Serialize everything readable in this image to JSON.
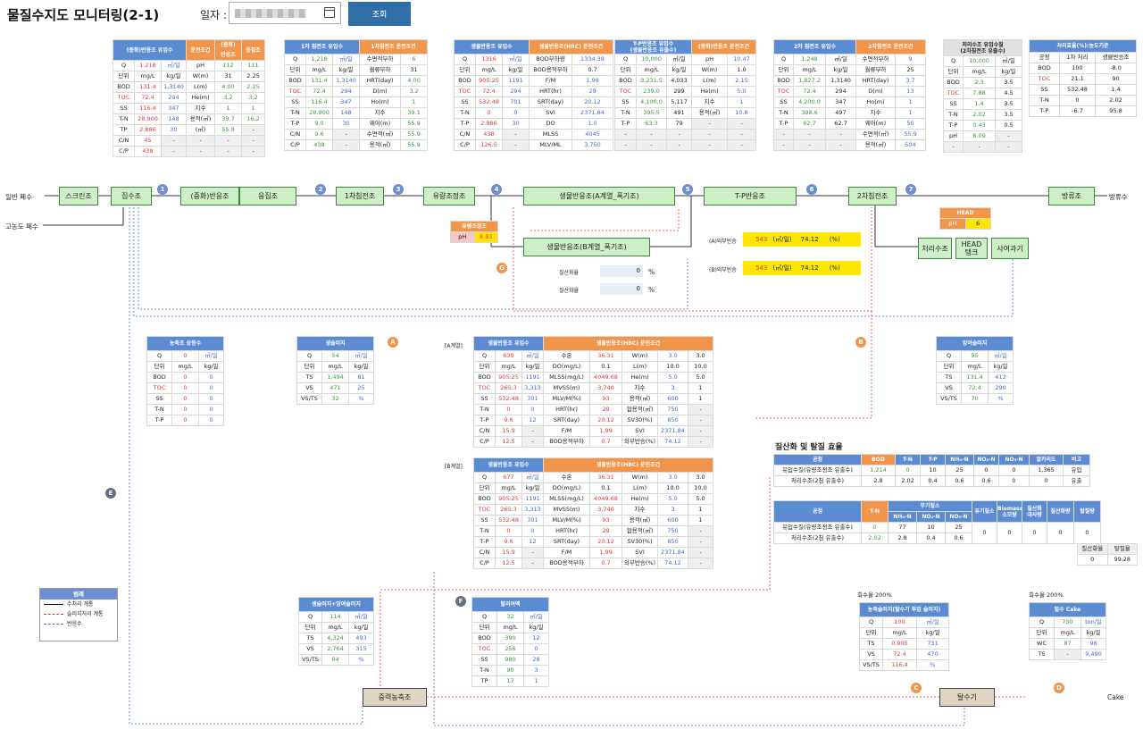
{
  "header": {
    "title": "물질수지도 모니터링(2-1)",
    "date_label": "일자 :",
    "search_label": "조회"
  },
  "flow": {
    "inlet_general": "일반 폐수",
    "inlet_high": "고농도 폐수",
    "outlet": "방류수",
    "cake": "Cake",
    "screen": "스크린조",
    "collect": "집수조",
    "neutral": "(중화)반응조",
    "coag": "응집조",
    "primary": "1차침전조",
    "eq": "유량조정조",
    "bio_a": "생물반응조(A계열_폭기조)",
    "bio_b": "생물반응조(B계열_폭기조)",
    "tp": "T-P반응조",
    "secondary": "2차침전조",
    "discharge": "방류조",
    "treat": "처리수조",
    "head": "HEAD\n탱크",
    "sand": "사여과기",
    "thickener": "중력농축조",
    "dewater": "탈수기",
    "ph_eq_title": "유량조정조",
    "ph_eq_label": "pH",
    "ph_eq_value": "8.93",
    "head_title": "HEAD",
    "head_ph_label": "pH",
    "head_ph_value": "6",
    "ret_a_label": "(A)외부반송",
    "ret_a_val": "543",
    "ret_a_unit": "(㎥/일)",
    "ret_a_pct": "74.12",
    "ret_a_pu": "(%)",
    "ret_b_label": "(B)외부반송",
    "ret_b_val": "543",
    "ret_b_unit": "(㎥/일)",
    "ret_b_pct": "74.12",
    "ret_b_pu": "(%)",
    "nit1_label": "질산화율",
    "nit1_val": "0",
    "nit1_unit": "%",
    "nit2_label": "질산화율",
    "nit2_val": "0",
    "nit2_unit": "%",
    "circles": [
      "1",
      "2",
      "3",
      "4",
      "5",
      "6",
      "7",
      "G",
      "A",
      "B",
      "E",
      "F",
      "C",
      "D"
    ]
  },
  "tables": {
    "t1": {
      "h": [
        "(중화)반응조 유입수",
        "운전조건",
        "(중화)\n반응조",
        "응집조"
      ],
      "rows": [
        [
          "Q",
          "1,218",
          "㎥/일",
          "pH",
          "112",
          "111"
        ],
        [
          "단위",
          "mg/L",
          "kg/일",
          "W(m)",
          "31",
          "2.25"
        ],
        [
          "BOD",
          "131.4",
          "1,3140",
          "L(m)",
          "4.00",
          "2.25"
        ],
        [
          "TOC",
          "72.4",
          "294",
          "He(m)",
          "3.2",
          "3.2"
        ],
        [
          "SS",
          "116.4",
          "347",
          "지수",
          "1",
          "1"
        ],
        [
          "T-N",
          "28.900",
          "148",
          "용적(㎥)",
          "39.7",
          "16.2"
        ],
        [
          "TP",
          "2.886",
          "30",
          "(㎥)",
          "55.9",
          "-"
        ],
        [
          "C/N",
          "45",
          "-",
          "-",
          "-",
          "-"
        ],
        [
          "C/P",
          "438",
          "-",
          "-",
          "-",
          "-"
        ]
      ]
    },
    "t2": {
      "h": [
        "1차 침전조 유입수",
        "1차침전조 운전조건"
      ],
      "rows": [
        [
          "Q",
          "1,218",
          "㎥/일",
          "수면적부하",
          "6"
        ],
        [
          "단위",
          "mg/L",
          "kg/일",
          "월류부하",
          "31"
        ],
        [
          "BOD",
          "131.4",
          "1,3140",
          "HRT(day)",
          "4.00"
        ],
        [
          "TOC",
          "72.4",
          "294",
          "D(m)",
          "3.2"
        ],
        [
          "SS",
          "116.4",
          "347",
          "Ho(m)",
          "1"
        ],
        [
          "T-N",
          "28.900",
          "148",
          "지수",
          "39.1"
        ],
        [
          "T-P",
          "9.0",
          "30",
          "웨어(m)",
          "55.9"
        ],
        [
          "C/N",
          "9.6",
          "-",
          "수면적(㎡)",
          "55.9"
        ],
        [
          "C/P",
          "438",
          "-",
          "용적(㎥)",
          "55.9"
        ]
      ]
    },
    "t3": {
      "h": [
        "생물반응조 유입수",
        "생물반응조(HRC) 운전조건"
      ],
      "rows": [
        [
          "Q",
          "1316",
          "㎥/일",
          "BOD부하량",
          "1334.38"
        ],
        [
          "단위",
          "mg/L",
          "kg/일",
          "BOD용적부하",
          "0.7"
        ],
        [
          "BOD",
          "905.25",
          "1191",
          "F/M",
          "1.99"
        ],
        [
          "TOC",
          "72.4",
          "294",
          "HRT(hr)",
          "29"
        ],
        [
          "SS",
          "532.48",
          "701",
          "SRT(day)",
          "20.12"
        ],
        [
          "T-N",
          "0",
          "0",
          "SVI",
          "2371.84"
        ],
        [
          "T-P",
          "2.886",
          "30",
          "DO",
          "1.0"
        ],
        [
          "C/N",
          "438",
          "-",
          "MLSS",
          "4045"
        ],
        [
          "C/P",
          "126.5",
          "-",
          "MLV/ML",
          "3.750"
        ]
      ]
    },
    "t4": {
      "h": [
        "T-P반응조 유입수\n(생물반응조 유출수)",
        "(중화)반응조 운전조건"
      ],
      "rows": [
        [
          "Q",
          "10,000",
          "㎥/일",
          "pH",
          "10.47"
        ],
        [
          "단위",
          "mg/L",
          "kg/일",
          "W(m)",
          "1.0"
        ],
        [
          "BOD",
          "3,231.5",
          "4,033",
          "L(m)",
          "2.15"
        ],
        [
          "TOC",
          "239.0",
          "299",
          "He(m)",
          "5.0"
        ],
        [
          "SS",
          "4,100.0",
          "5,117",
          "지수",
          "1"
        ],
        [
          "T-N",
          "395.5",
          "491",
          "용적(㎥)",
          "10.8"
        ],
        [
          "T-P",
          "63.3",
          "79",
          "-",
          "-"
        ],
        [
          "-",
          "-",
          "-",
          "-",
          "-"
        ],
        [
          "-",
          "-",
          "-",
          "-",
          "-"
        ]
      ]
    },
    "t5": {
      "h": [
        "2차 침전조 유입수",
        "2차침전조 운전조건"
      ],
      "rows": [
        [
          "Q",
          "1,248",
          "㎥/일",
          "수면적부하",
          "9"
        ],
        [
          "단위",
          "mg/L",
          "kg/일",
          "월류부하",
          "25"
        ],
        [
          "BOD",
          "1,827.2",
          "1,3140",
          "HRT(day)",
          "3.7"
        ],
        [
          "TOC",
          "72.4",
          "294",
          "D(m)",
          "13"
        ],
        [
          "SS",
          "4,200.0",
          "347",
          "Ho(m)",
          "1"
        ],
        [
          "T-N",
          "398.6",
          "497",
          "지수",
          "1"
        ],
        [
          "T-P",
          "62.7",
          "62.7",
          "웨어(m)",
          "50"
        ],
        [
          "-",
          "-",
          "-",
          "수면적(㎡)",
          "55.9"
        ],
        [
          "-",
          "-",
          "-",
          "용적(㎥)",
          "504"
        ]
      ]
    },
    "t6": {
      "h": [
        "처리수조 유입수질\n(2차침전조 유출수)"
      ],
      "rows": [
        [
          "Q",
          "10,000",
          "㎥/일"
        ],
        [
          "단위",
          "mg/L",
          "kg/일"
        ],
        [
          "BOD",
          "2.3",
          "3.5"
        ],
        [
          "TOC",
          "7.88",
          "4.5"
        ],
        [
          "SS",
          "1.4",
          "3.5"
        ],
        [
          "T-N",
          "2.02",
          "3.5"
        ],
        [
          "T-P",
          "0.43",
          "0.5"
        ],
        [
          "pH",
          "8.09",
          "-"
        ],
        [
          "-",
          "-",
          "-"
        ]
      ]
    },
    "t7": {
      "h": [
        "처리효율(%):농도기준"
      ],
      "rows": [
        [
          "공정",
          "1차 처리",
          "생물반응조"
        ],
        [
          "BOD",
          "100",
          "-8.0"
        ],
        [
          "TOC",
          "21.1",
          "90"
        ],
        [
          "SS",
          "532.48",
          "1.4"
        ],
        [
          "T-N",
          "0",
          "2.02"
        ],
        [
          "T-P",
          "-6.7",
          "95.8"
        ]
      ]
    },
    "thick": {
      "h": [
        "농축조 상등수"
      ],
      "rows": [
        [
          "Q",
          "0",
          "㎥/일"
        ],
        [
          "단위",
          "mg/L",
          "kg/일"
        ],
        [
          "BOD",
          "0",
          "0"
        ],
        [
          "TOC",
          "0",
          "0"
        ],
        [
          "SS",
          "0",
          "0"
        ],
        [
          "T-N",
          "0",
          "0"
        ],
        [
          "T-P",
          "0",
          "0"
        ]
      ]
    },
    "raw": {
      "h": [
        "생슬러지"
      ],
      "rows": [
        [
          "Q",
          "54",
          "㎥/일"
        ],
        [
          "단위",
          "mg/L",
          "kg/일"
        ],
        [
          "TS",
          "1,494",
          "81"
        ],
        [
          "VS",
          "471",
          "25"
        ],
        [
          "VS/TS",
          "32",
          "%"
        ]
      ]
    },
    "excess": {
      "h": [
        "잉여슬러지"
      ],
      "rows": [
        [
          "Q",
          "95",
          "㎥/일"
        ],
        [
          "단위",
          "mg/L",
          "kg/일"
        ],
        [
          "TS",
          "131.4",
          "412"
        ],
        [
          "VS",
          "72.4",
          "290"
        ],
        [
          "VS/TS",
          "70",
          "%"
        ]
      ]
    },
    "mix": {
      "h": [
        "생슬러지+잉여슬러지"
      ],
      "rows": [
        [
          "Q",
          "114",
          "㎥/일"
        ],
        [
          "단위",
          "mg/L",
          "kg/일"
        ],
        [
          "TS",
          "4,324",
          "493"
        ],
        [
          "VS",
          "2,764",
          "315"
        ],
        [
          "VS/TS",
          "64",
          "%"
        ]
      ]
    },
    "filt": {
      "h": [
        "탈리여액"
      ],
      "rows": [
        [
          "Q",
          "32",
          "㎥/일"
        ],
        [
          "단위",
          "mg/L",
          "kg/일"
        ],
        [
          "BOD",
          "390",
          "12"
        ],
        [
          "TOC",
          "256",
          "0"
        ],
        [
          "SS",
          "980",
          "28"
        ],
        [
          "T-N",
          "90",
          "3"
        ],
        [
          "TP",
          "17",
          "1"
        ]
      ]
    },
    "thk2": {
      "h": [
        "농축슬러지(탈수기 투입 슬러지)"
      ],
      "rows": [
        [
          "Q",
          "100",
          "㎥/일"
        ],
        [
          "단위",
          "mg/L",
          "kg/일"
        ],
        [
          "TS",
          "0.905",
          "731"
        ],
        [
          "VS",
          "72.4",
          "470"
        ],
        [
          "VS/TS",
          "116.4",
          "%"
        ]
      ]
    },
    "cake": {
      "h": [
        "탈수 Cake"
      ],
      "rows": [
        [
          "Q",
          "730",
          "ton/일"
        ],
        [
          "단위",
          "mg/L",
          "kg/일"
        ],
        [
          "WC",
          "87",
          "96"
        ],
        [
          "TS",
          "-",
          "9,490"
        ]
      ]
    },
    "bio": {
      "h": [
        "생물반응조 유입수",
        "생물반응조(HBC) 운전조건"
      ],
      "rows": [
        [
          "Q",
          "639",
          "㎥/일",
          "수온",
          "36.31",
          "W(m)",
          "3.0",
          "3.0"
        ],
        [
          "단위",
          "mg/L",
          "kg/일",
          "DO(mg/L)",
          "0.1",
          "L(m)",
          "10.0",
          "10.0"
        ],
        [
          "BOD",
          "905.25",
          "1191",
          "MLSS(mg/L)",
          "4049.68",
          "He(m)",
          "5.0",
          "5.0"
        ],
        [
          "TOC",
          "265.3",
          "3,313",
          "MVSS(m)",
          "3,740",
          "지수",
          "3",
          "1"
        ],
        [
          "SS",
          "532.48",
          "701",
          "MLV/M(%)",
          "93",
          "용적(㎥)",
          "600",
          "1"
        ],
        [
          "T-N",
          "0",
          "0",
          "HRT(hr)",
          "29",
          "합용적(㎥)",
          "750",
          "-"
        ],
        [
          "T-P",
          "9.6",
          "12",
          "SRT(day)",
          "20.12",
          "SV30(%)",
          "850",
          "-"
        ],
        [
          "C/N",
          "15.9",
          "-",
          "F/M",
          "1.99",
          "SVI",
          "2371.84",
          "-"
        ],
        [
          "C/P",
          "12.5",
          "-",
          "BOD용적부하",
          "0.7",
          "외부반송(%)",
          "74.12",
          "-"
        ]
      ]
    },
    "bioB_q": "677",
    "nitr": {
      "h": [
        "공정",
        "BOD",
        "T-N",
        "T-P",
        "NH₄-N",
        "NO₂-N",
        "NO₃-N",
        "알카리도",
        "비고"
      ],
      "rows": [
        [
          "유입수질(유량조정조 유출수)",
          "1,214",
          "0",
          "10",
          "25",
          "0",
          "0",
          "1,365",
          "유입"
        ],
        [
          "처리수조(2침 유출수)",
          "2.8",
          "2.02",
          "0.4",
          "0.6",
          "0.6",
          "0",
          "0",
          "유출"
        ]
      ]
    },
    "nitr2": {
      "h": [
        "공정",
        "T-N",
        "무기질소",
        "NH₄-N",
        "NO₂-N",
        "NO₃-N",
        "유기질소",
        "Biomass\n소모량",
        "질산화\n대사량",
        "질산화량",
        "탈질량"
      ],
      "rows": [
        [
          "유입수질(유량조정조 유출수)",
          "0",
          "77",
          "10",
          "25"
        ],
        [
          "처리수조(2침 유출수)",
          "2.02",
          "2.8",
          "0.4",
          "0.6"
        ]
      ],
      "merged": [
        "0",
        "0",
        "0",
        "0",
        "0"
      ],
      "foot": [
        "질산화율",
        "탈질율",
        "0",
        "99.28"
      ]
    }
  },
  "labels": {
    "block_a": "[A계열]",
    "block_b": "[B계열]",
    "nitr_title": "질산화 및 탈질 효율",
    "ret_rate1_label": "회수율",
    "ret_rate1": "200%",
    "ret_rate2_label": "회수율",
    "ret_rate2": "200%"
  },
  "legend": {
    "title": "범례",
    "items": [
      "수처리 계통",
      "슬러지처리 계통",
      "반응수"
    ]
  },
  "colors": {
    "blue_header": "#5b8bd3",
    "orange_header": "#f0954a",
    "process_box": "#cdeec6"
  }
}
